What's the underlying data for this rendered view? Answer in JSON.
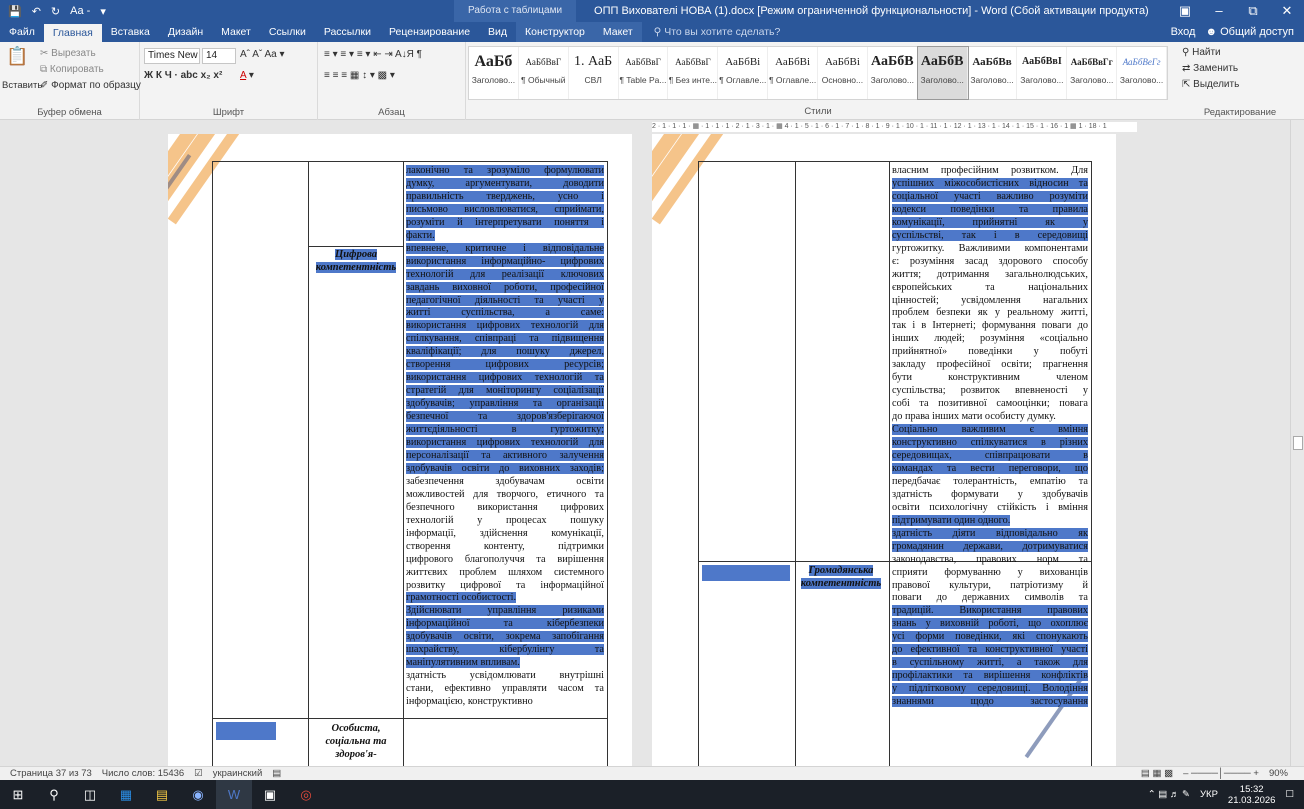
{
  "titlebar": {
    "undo_label": "Aa -",
    "context_group": "Работа с таблицами",
    "doc_title": "ОПП Вихователі НОВА (1).docx [Режим ограниченной функциональности] - Word (Сбой активации продукта)"
  },
  "tabs": [
    "Файл",
    "Главная",
    "Вставка",
    "Дизайн",
    "Макет",
    "Ссылки",
    "Рассылки",
    "Рецензирование",
    "Вид"
  ],
  "context_tabs": [
    "Конструктор",
    "Макет"
  ],
  "tellme": "Что вы хотите сделать?",
  "account": {
    "login": "Вход",
    "share": "Общий доступ"
  },
  "ribbon": {
    "clipboard": {
      "paste": "Вставить",
      "cut": "Вырезать",
      "copy": "Копировать",
      "painter": "Формат по образцу",
      "label": "Буфер обмена"
    },
    "font": {
      "name": "Times New F",
      "size": "14",
      "label": "Шрифт"
    },
    "paragraph": {
      "label": "Абзац"
    },
    "styles": {
      "label": "Стили",
      "items": [
        {
          "preview": "АаБб",
          "name": "Заголово..."
        },
        {
          "preview": "АаБбВвГ",
          "name": "¶ Обычный"
        },
        {
          "preview": "1. АаБ",
          "name": "СВЛ"
        },
        {
          "preview": "АаБбВвГ",
          "name": "¶ Table Pa..."
        },
        {
          "preview": "АаБбВвГ",
          "name": "¶ Без инте..."
        },
        {
          "preview": "АаБбВі",
          "name": "¶ Оглавле..."
        },
        {
          "preview": "АаБбВі",
          "name": "¶ Оглавле..."
        },
        {
          "preview": "АаБбВі",
          "name": "Основно..."
        },
        {
          "preview": "АаБбВ",
          "name": "Заголово..."
        },
        {
          "preview": "АаБбВ",
          "name": "Заголово..."
        },
        {
          "preview": "АаБбВв",
          "name": "Заголово..."
        },
        {
          "preview": "АаБбВвІ",
          "name": "Заголово..."
        },
        {
          "preview": "АаБбВвГг",
          "name": "Заголово..."
        },
        {
          "preview": "АаБбВеГг",
          "name": "Заголово..."
        }
      ]
    },
    "editing": {
      "find": "Найти",
      "replace": "Заменить",
      "select": "Выделить",
      "label": "Редактирование"
    }
  },
  "ruler": "2 · 1 · 1 · 1 · ▦ · 1 · 1 · 1 · 2 · 1 · 3 · 1 · ▦ 4 · 1 · 5 · 1 · 6 · 1 · 7 · 1 · 8 · 1 · 9 · 1 · 10 · 1 · 11 · 1 · 12 · 1 · 13 · 1 · 14 · 1 · 15 · 1 · 16 · 1 ▦ 1 · 18 · 1",
  "left_page": {
    "name_digital": [
      "Цифрова",
      "компетентність"
    ],
    "name_personal": [
      "Особиста,",
      "соціальна та",
      "здоров'я-"
    ],
    "lines": [
      "лаконічно та зрозуміло формулювати",
      "думку, аргументувати, доводити",
      "правильність тверджень, усно і",
      "письмово висловлюватися, сприймати,",
      "розуміти й інтерпретувати поняття і",
      "факти.",
      "впевнене, критичне і відповідальне",
      "використання інформаційно- цифрових",
      "технологій для реалізації ключових",
      "завдань виховної роботи, професійної",
      "педагогічної діяльності та участі у",
      "житті суспільства, а саме:",
      "використання цифрових технологій для",
      "спілкування, співпраці та підвищення",
      "кваліфікації; для пошуку джерел,",
      "створення цифрових ресурсів;",
      "використання цифрових технологій та",
      "стратегій для моніторингу соціалізації",
      "здобувачів; управління та організації",
      "безпечної та здоров'язберігаючої",
      "життєдіяльності в гуртожитку;",
      "використання цифрових технологій для",
      "персоналізації та активного залучення",
      "здобувачів освіти до виховних заходів;",
      "забезпечення здобувачам освіти",
      "можливостей для творчого, етичного та",
      "безпечного використання цифрових",
      "технологій у процесах пошуку",
      "інформації, здійснення комунікації,",
      "створення контенту, підтримки",
      "цифрового благополуччя та вирішення",
      "життєвих проблем шляхом системного",
      "розвитку цифрової та інформаційної",
      "грамотності особистості.",
      "Здійснювати управління ризиками",
      "інформаційної та кібербезпеки",
      "здобувачів освіти, зокрема запобігання",
      "шахрайству, кібербулінгу та",
      "маніпулятивним впливам.",
      "здатність усвідомлювати внутрішні",
      "стани, ефективно управляти часом та",
      "інформацією, конструктивно"
    ]
  },
  "right_page": {
    "name_civic": [
      "Громадянська",
      "компетентність"
    ],
    "lines": [
      "власним професійним розвитком. Для",
      "успішних міжособистісних відносин та",
      "соціальної участі важливо розуміти",
      "кодекси поведінки та правила",
      "комунікації, прийнятні як у",
      "суспільстві, так і в середовищі",
      "гуртожитку. Важливими компонентами",
      "є: розуміння засад здорового способу",
      "життя; дотримання загальнолюдських,",
      "європейських та національних",
      "цінностей; усвідомлення нагальних",
      "проблем безпеки як у реальному житті,",
      "так і в Інтернеті; формування поваги до",
      "інших людей; розуміння «соціально",
      "прийнятної» поведінки у побуті",
      "закладу професійної освіти; прагнення",
      "бути конструктивним членом",
      "суспільства; розвиток впевненості у",
      "собі та позитивної самооцінки; повага",
      "до права інших мати особисту думку.",
      "Соціально важливим є вміння",
      "конструктивно спілкуватися в різних",
      "середовищах, співпрацювати в",
      "командах та вести переговори, що",
      "передбачає толерантність, емпатію та",
      "здатність формувати у здобувачів",
      "освіти психологічну стійкість і вміння",
      "підтримувати один одного.",
      "здатність діяти відповідально як",
      "громадянин держави, дотримуватися",
      "законодавства, правових норм та",
      "сприяти формуванню у вихованців",
      "правової культури, патріотизму й",
      "поваги до державних символів та",
      "традицій. Використання правових",
      "знань у виховній роботі, що охоплює",
      "усі форми поведінки, які спонукають",
      "до ефективної та конструктивної участі",
      "в суспільному житті, а також для",
      "профілактики та вирішення конфліктів",
      "у підлітковому середовищі. Володіння",
      "знаннями щодо застосування"
    ]
  },
  "statusbar": {
    "page": "Страница 37 из 73",
    "words": "Число слов: 15436",
    "lang": "украинский",
    "zoom": "90%"
  },
  "tray": {
    "lang": "УКР",
    "time": "15:32",
    "date": "21.03.2026"
  },
  "colors": {
    "accent": "#2b579a",
    "highlight": "#4e78c9"
  }
}
